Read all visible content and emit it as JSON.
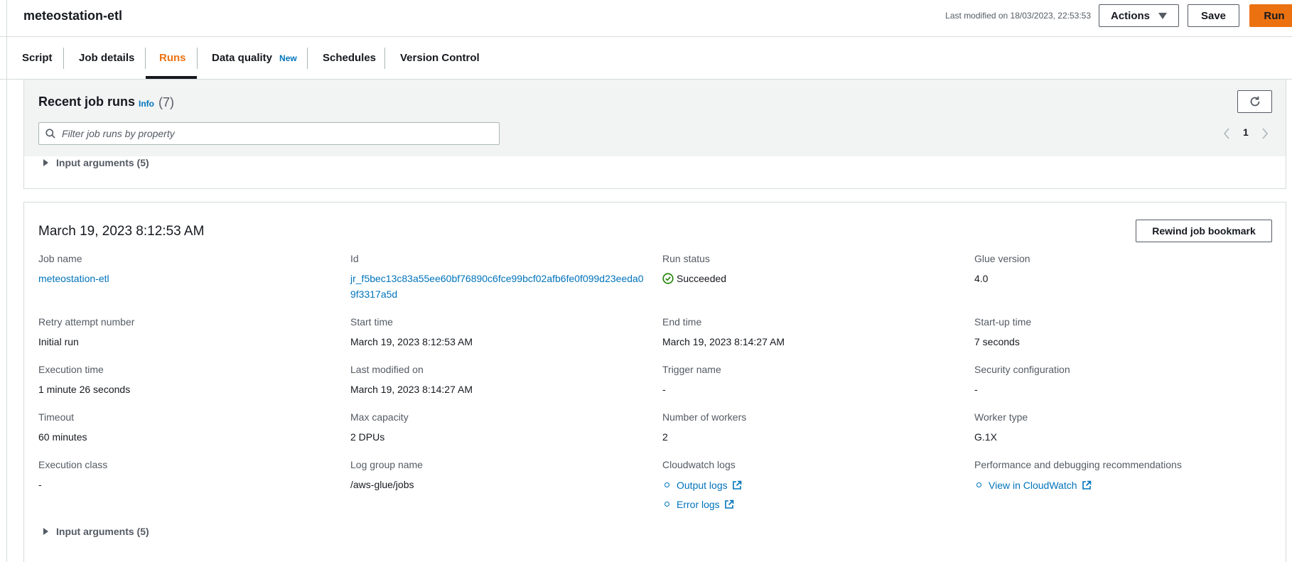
{
  "header": {
    "title": "meteostation-etl",
    "last_modified": "Last modified on 18/03/2023, 22:53:53",
    "actions_label": "Actions",
    "save_label": "Save",
    "run_label": "Run"
  },
  "tabs": [
    {
      "label": "Script"
    },
    {
      "label": "Job details"
    },
    {
      "label": "Runs",
      "active": true
    },
    {
      "label": "Data quality",
      "badge": "New"
    },
    {
      "label": "Schedules"
    },
    {
      "label": "Version Control"
    }
  ],
  "recent_runs": {
    "title": "Recent job runs",
    "info": "Info",
    "count": "(7)",
    "filter_placeholder": "Filter job runs by property",
    "page": "1"
  },
  "previous_run": {
    "input_arguments": "Input arguments (5)"
  },
  "run": {
    "title": "March 19, 2023 8:12:53 AM",
    "rewind_label": "Rewind job bookmark",
    "fields": {
      "job_name": {
        "label": "Job name",
        "value": "meteostation-etl"
      },
      "id": {
        "label": "Id",
        "value": "jr_f5bec13c83a55ee60bf76890c6fce99bcf02afb6fe0f099d23eeda09f3317a5d"
      },
      "run_status": {
        "label": "Run status",
        "value": "Succeeded"
      },
      "glue_version": {
        "label": "Glue version",
        "value": "4.0"
      },
      "retry_attempt": {
        "label": "Retry attempt number",
        "value": "Initial run"
      },
      "start_time": {
        "label": "Start time",
        "value": "March 19, 2023 8:12:53 AM"
      },
      "end_time": {
        "label": "End time",
        "value": "March 19, 2023 8:14:27 AM"
      },
      "startup_time": {
        "label": "Start-up time",
        "value": "7 seconds"
      },
      "execution_time": {
        "label": "Execution time",
        "value": "1 minute 26 seconds"
      },
      "last_modified_on": {
        "label": "Last modified on",
        "value": "March 19, 2023 8:14:27 AM"
      },
      "trigger_name": {
        "label": "Trigger name",
        "value": "-"
      },
      "security_configuration": {
        "label": "Security configuration",
        "value": "-"
      },
      "timeout": {
        "label": "Timeout",
        "value": "60 minutes"
      },
      "max_capacity": {
        "label": "Max capacity",
        "value": "2 DPUs"
      },
      "number_of_workers": {
        "label": "Number of workers",
        "value": "2"
      },
      "worker_type": {
        "label": "Worker type",
        "value": "G.1X"
      },
      "execution_class": {
        "label": "Execution class",
        "value": "-"
      },
      "log_group_name": {
        "label": "Log group name",
        "value": "/aws-glue/jobs"
      },
      "cloudwatch_logs": {
        "label": "Cloudwatch logs",
        "links": [
          "Output logs",
          "Error logs"
        ]
      },
      "performance": {
        "label": "Performance and debugging recommendations",
        "links": [
          "View in CloudWatch"
        ]
      }
    },
    "input_arguments": "Input arguments (5)"
  },
  "colors": {
    "accent": "#ec7211",
    "link": "#0073bb",
    "success": "#1d8102"
  }
}
